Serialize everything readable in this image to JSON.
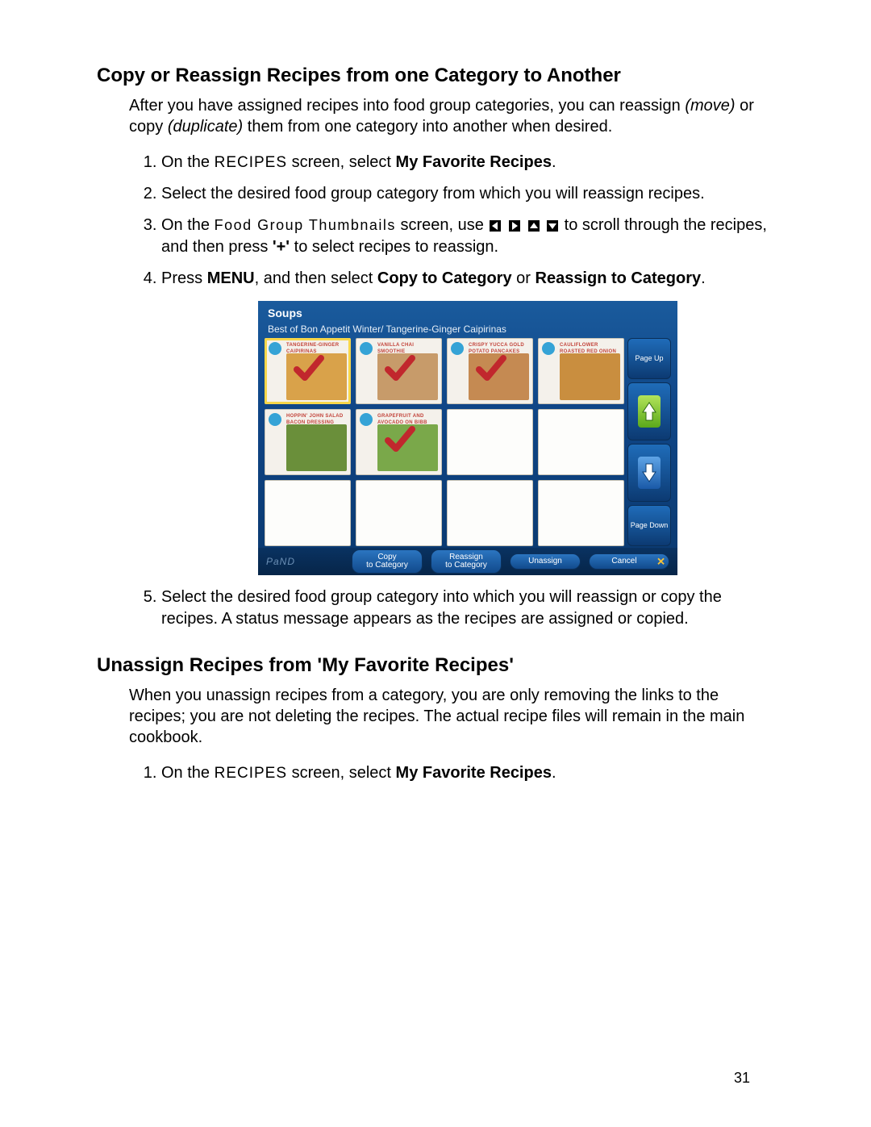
{
  "page_number": "31",
  "section1": {
    "heading": "Copy or Reassign Recipes from one Category to Another",
    "intro_parts": {
      "a": "After you have assigned recipes into food group categories, you can reassign ",
      "move": "(move)",
      "b": " or copy ",
      "dup": "(duplicate)",
      "c": " them from one category into another when desired."
    },
    "step1": {
      "a": "On the ",
      "recipes": "RECIPES",
      "b": " screen, select ",
      "bold": "My Favorite Recipes",
      "c": "."
    },
    "step2": "Select the desired food group category from which you will reassign recipes.",
    "step3": {
      "a": "On the ",
      "thumb": "Food Group Thumbnails",
      "b": " screen, use ",
      "c": " to scroll through the recipes, and then press ",
      "plus": "'+'",
      "d": " to select recipes to reassign."
    },
    "step4": {
      "a": "Press ",
      "menu": "MENU",
      "b": ", and then select ",
      "copy": "Copy to Category",
      "c": " or ",
      "reassign": "Reassign to Category",
      "d": "."
    },
    "step5": "Select the desired food group category into which you will reassign or copy the recipes. A status message appears as the recipes are assigned or copied."
  },
  "device": {
    "title": "Soups",
    "subtitle": "Best of Bon Appetit Winter/ Tangerine-Ginger Caipirinas",
    "page_up": "Page Up",
    "page_down": "Page Down",
    "brand": "PaND",
    "buttons": {
      "copy1": "Copy",
      "copy2": "to Category",
      "re1": "Reassign",
      "re2": "to Category",
      "un": "Unassign",
      "cancel": "Cancel"
    },
    "thumbs": [
      {
        "label": "TANGERINE-GINGER CAIPIRINAS",
        "color": "#d9a24a",
        "checked": true,
        "selected": true
      },
      {
        "label": "VANILLA CHAI SMOOTHIE",
        "color": "#c79b6a",
        "checked": true,
        "selected": false
      },
      {
        "label": "CRISPY YUCCA GOLD POTATO PANCAKES",
        "color": "#c58a52",
        "checked": true,
        "selected": false
      },
      {
        "label": "CAULIFLOWER ROASTED RED ONION TART",
        "color": "#c98e3f",
        "checked": false,
        "selected": false
      },
      {
        "label": "HOPPIN' JOHN SALAD BACON DRESSING",
        "color": "#6a8f3a",
        "checked": false,
        "selected": false
      },
      {
        "label": "GRAPEFRUIT AND AVOCADO ON BIBB",
        "color": "#7aa84a",
        "checked": true,
        "selected": false
      }
    ]
  },
  "section2": {
    "heading": "Unassign Recipes from 'My Favorite Recipes'",
    "intro": "When you unassign recipes from a category, you are only removing the links to the recipes; you are not deleting the recipes. The actual recipe files will remain in the main cookbook.",
    "step1": {
      "a": "On the ",
      "recipes": "RECIPES",
      "b": " screen, select ",
      "bold": "My Favorite Recipes",
      "c": "."
    }
  }
}
